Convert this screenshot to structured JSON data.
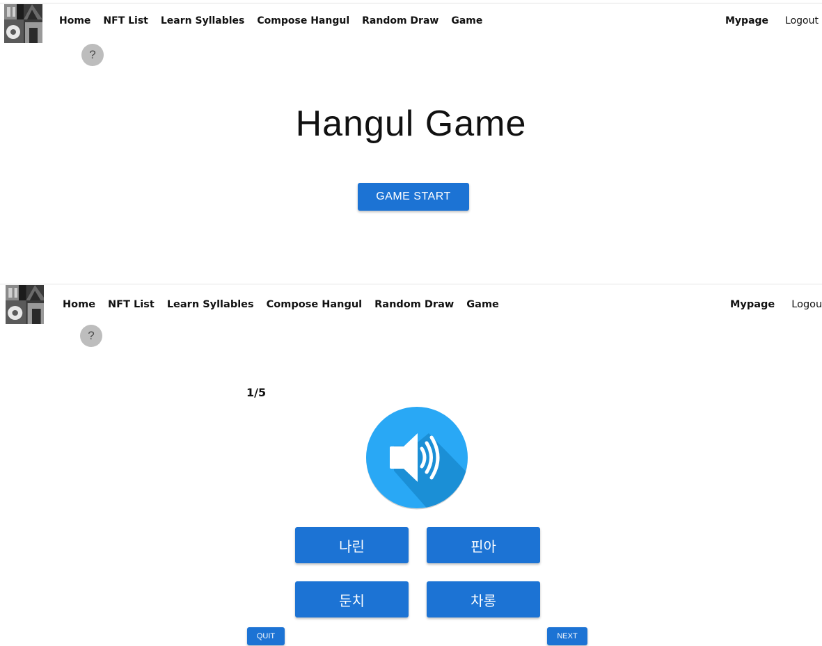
{
  "screen1": {
    "nav": {
      "items": [
        "Home",
        "NFT List",
        "Learn Syllables",
        "Compose Hangul",
        "Random Draw",
        "Game"
      ],
      "mypage": "Mypage",
      "logout": "Logout"
    },
    "help": "?",
    "title": "Hangul Game",
    "start_button": "GAME START"
  },
  "screen2": {
    "nav": {
      "items": [
        "Home",
        "NFT List",
        "Learn Syllables",
        "Compose Hangul",
        "Random Draw",
        "Game"
      ],
      "mypage": "Mypage",
      "logout": "Logou"
    },
    "help": "?",
    "progress": "1/5",
    "speaker_icon": "speaker-volume-icon",
    "choices": [
      "나린",
      "핀아",
      "둔치",
      "차롱"
    ],
    "quit_button": "QUIT",
    "next_button": "NEXT"
  },
  "colors": {
    "button": "#1c73d4",
    "speaker": "#29a8f5",
    "help_bg": "#bdbdbd"
  }
}
